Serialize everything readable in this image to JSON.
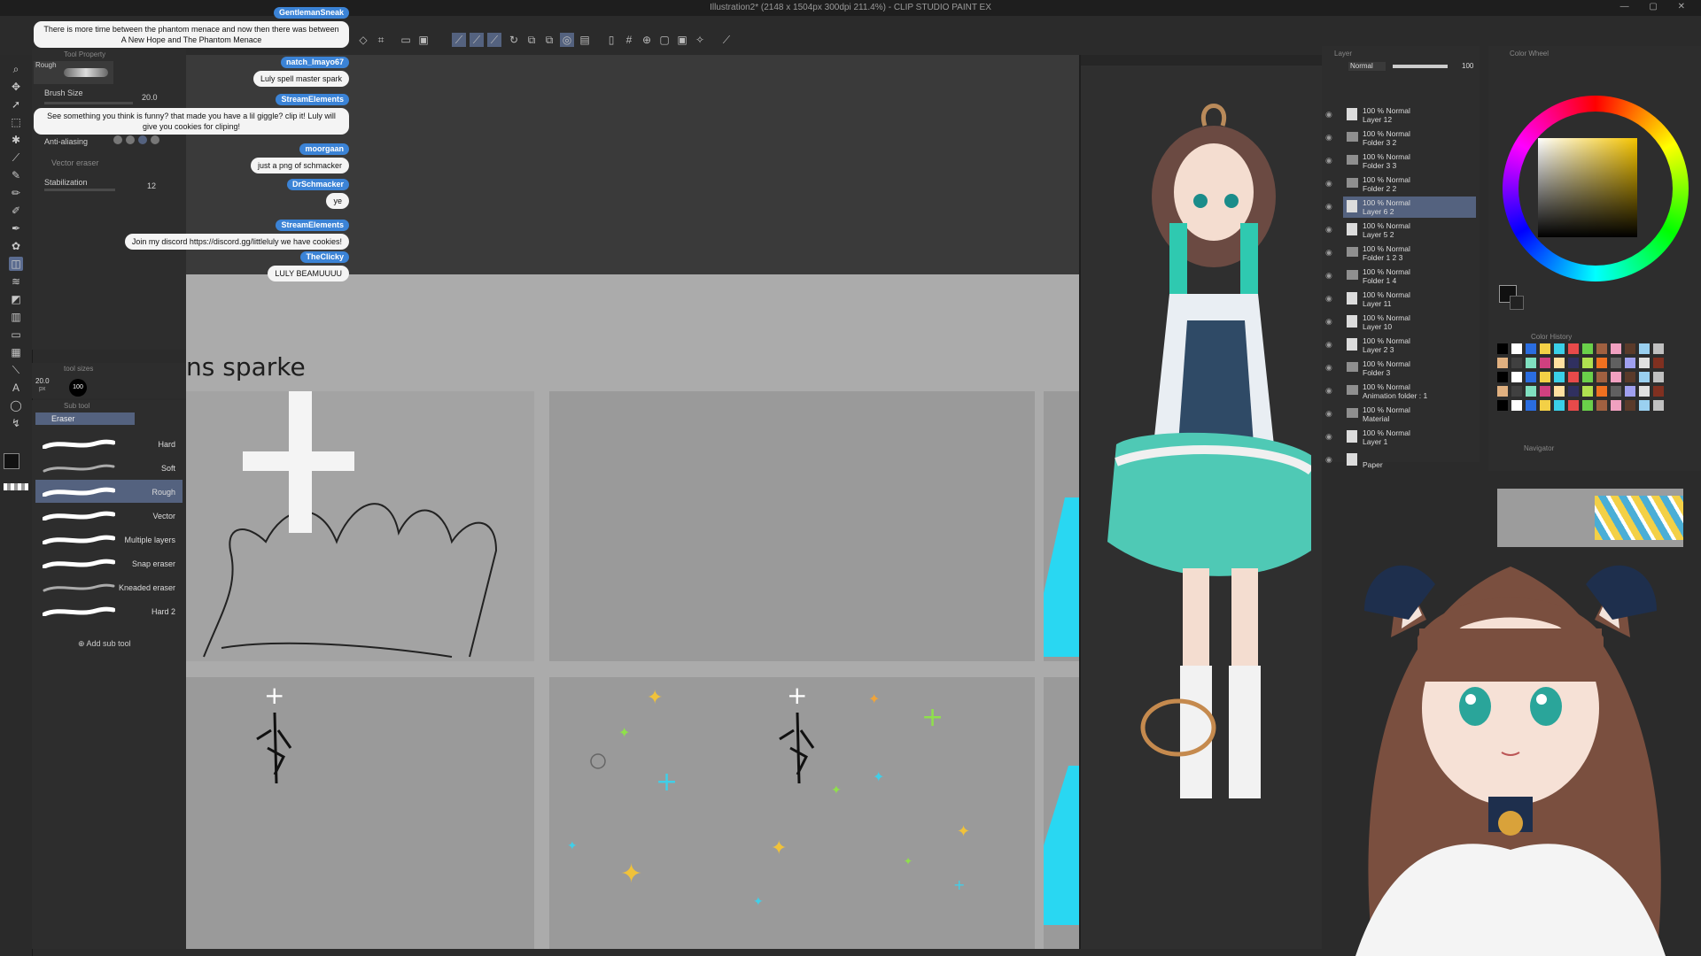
{
  "window": {
    "title": "Illustration2* (2148 x 1504px 300dpi 211.4%) - CLIP STUDIO PAINT EX"
  },
  "tool_property": {
    "tab_label": "Tool Property",
    "brush_name": "Rough",
    "brush_size_label": "Brush Size",
    "brush_size_value": "20.0",
    "anti_aliasing_label": "Anti-aliasing",
    "vector_eraser_label": "Vector eraser",
    "stabilization_label": "Stabilization",
    "stabilization_value": "12"
  },
  "tool_sizes": {
    "label": "tool sizes",
    "size_value": "20.0",
    "size_unit": "px",
    "opacity_value": "100"
  },
  "sub_tool": {
    "tab_label": "Sub tool",
    "group_label": "Eraser",
    "items": [
      {
        "label": "Hard"
      },
      {
        "label": "Soft"
      },
      {
        "label": "Rough",
        "selected": true
      },
      {
        "label": "Vector"
      },
      {
        "label": "Multiple layers"
      },
      {
        "label": "Snap eraser"
      },
      {
        "label": "Kneaded eraser"
      },
      {
        "label": "Hard 2"
      }
    ],
    "add_label": "Add sub tool"
  },
  "canvas": {
    "sketch_text": "ns sparke"
  },
  "layers": {
    "blend_mode": "Normal",
    "opacity": "100",
    "items": [
      {
        "line1": "100 % Normal",
        "line2": "Layer 12",
        "kind": "layer"
      },
      {
        "line1": "100 % Normal",
        "line2": "Folder 3 2",
        "kind": "folder"
      },
      {
        "line1": "100 % Normal",
        "line2": "Folder 3 3",
        "kind": "folder"
      },
      {
        "line1": "100 % Normal",
        "line2": "Folder 2 2",
        "kind": "folder"
      },
      {
        "line1": "100 % Normal",
        "line2": "Layer 6 2",
        "kind": "layer",
        "selected": true
      },
      {
        "line1": "100 % Normal",
        "line2": "Layer 5 2",
        "kind": "layer"
      },
      {
        "line1": "100 % Normal",
        "line2": "Folder 1 2 3",
        "kind": "folder"
      },
      {
        "line1": "100 % Normal",
        "line2": "Folder 1 4",
        "kind": "folder"
      },
      {
        "line1": "100 % Normal",
        "line2": "Layer 11",
        "kind": "layer"
      },
      {
        "line1": "100 % Normal",
        "line2": "Layer 10",
        "kind": "layer"
      },
      {
        "line1": "100 % Normal",
        "line2": "Layer 2 3",
        "kind": "layer"
      },
      {
        "line1": "100 % Normal",
        "line2": "Folder 3",
        "kind": "folder"
      },
      {
        "line1": "100 % Normal",
        "line2": "Animation folder : 1",
        "kind": "folder"
      },
      {
        "line1": "100 % Normal",
        "line2": "Material",
        "kind": "folder"
      },
      {
        "line1": "100 % Normal",
        "line2": "Layer 1",
        "kind": "layer"
      },
      {
        "line1": "",
        "line2": "Paper",
        "kind": "paper"
      }
    ]
  },
  "color": {
    "wheel_tab": "Color Wheel",
    "history_tab": "Color History",
    "navigator_tab": "Navigator",
    "main_color": "#111111",
    "sub_color": "#ffffff"
  },
  "chat": [
    {
      "user": "GentlemanSneak",
      "text": "There is more time between the phantom menace and now then there was between A New Hope and The Phantom Menace"
    },
    {
      "user": "natch_lmayo67",
      "text": "Luly spell master spark"
    },
    {
      "user": "StreamElements",
      "text": "See something you think is funny? that made you have a lil giggle? clip it! Luly will give you cookies for cliping!"
    },
    {
      "user": "moorgaan",
      "text": "just a png of schmacker"
    },
    {
      "user": "DrSchmacker",
      "text": "ye"
    },
    {
      "user": "StreamElements",
      "text": "Join my discord https://discord.gg/littleluly we have cookies!"
    },
    {
      "user": "TheClicky",
      "text": "LULY BEAMUUUU"
    }
  ],
  "colors": {
    "accent": "#54627f",
    "chat_name": "#3b83d6"
  }
}
